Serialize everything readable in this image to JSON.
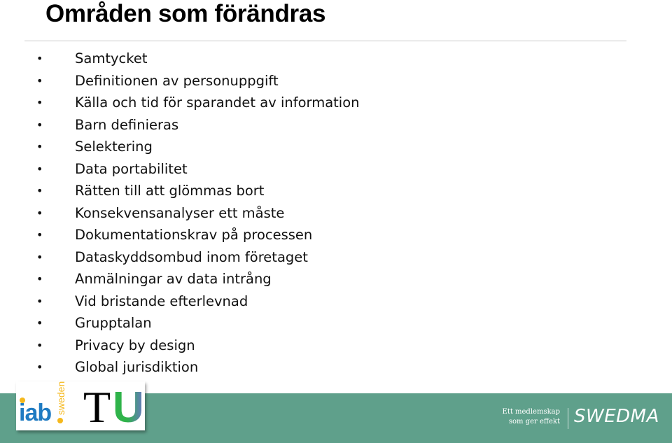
{
  "slide": {
    "title": "Områden som förändras",
    "bullet_glyph": "•",
    "items": [
      "Samtycket",
      "Definitionen av personuppgift",
      "Källa och tid för sparandet av information",
      "Barn definieras",
      "Selektering",
      "Data portabilitet",
      "Rätten till att glömmas bort",
      "Konsekvensanalyser ett måste",
      "Dokumentationskrav på processen",
      "Dataskyddsombud inom företaget",
      "Anmälningar av data intrång",
      "Vid bristande efterlevnad",
      "Grupptalan",
      "Privacy by design",
      "Global jurisdiktion"
    ]
  },
  "footer": {
    "background_color": "#5fa08b",
    "logos": {
      "iab_text": "iab",
      "iab_sub": "sweden",
      "tu_t": "T",
      "tu_u": "U"
    },
    "tagline_line1": "Ett medlemskap",
    "tagline_line2": "som ger effekt",
    "brand": "SWEDMA"
  }
}
